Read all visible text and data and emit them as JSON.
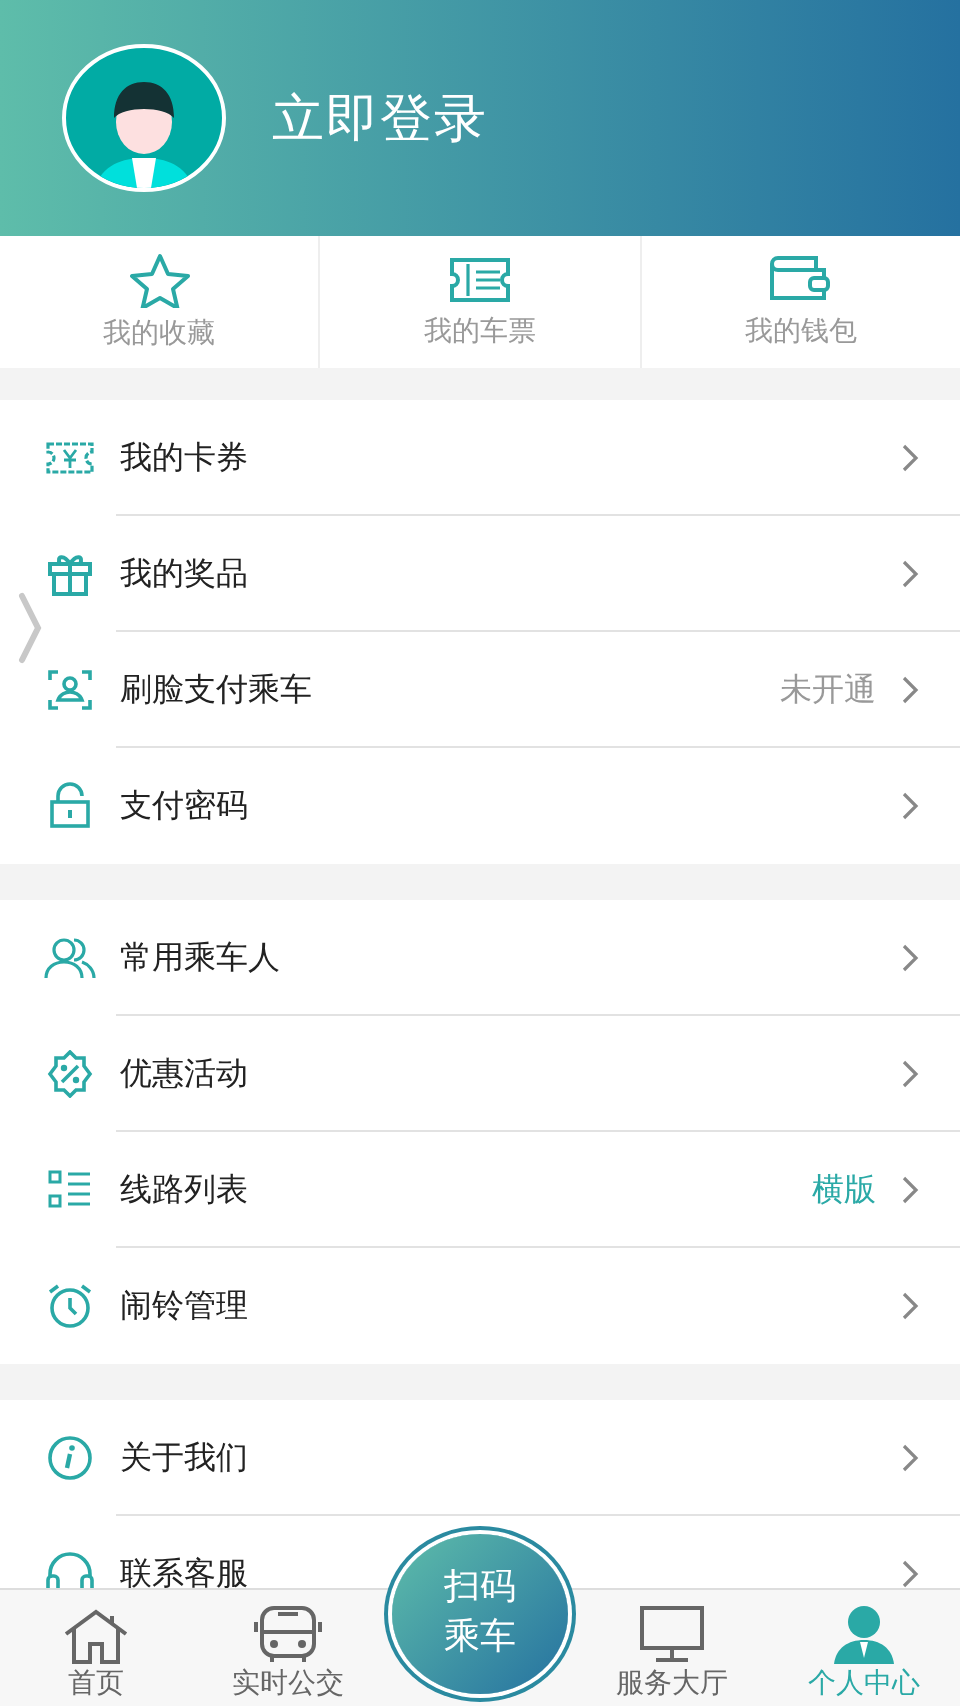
{
  "header": {
    "login_text": "立即登录"
  },
  "shortcuts": [
    {
      "label": "我的收藏"
    },
    {
      "label": "我的车票"
    },
    {
      "label": "我的钱包"
    }
  ],
  "menu_groups": [
    {
      "rows": [
        {
          "label": "我的卡券"
        },
        {
          "label": "我的奖品"
        },
        {
          "label": "刷脸支付乘车",
          "value": {
            "text": "未开通",
            "highlighted": false
          }
        },
        {
          "label": "支付密码"
        }
      ]
    },
    {
      "rows": [
        {
          "label": "常用乘车人"
        },
        {
          "label": "优惠活动"
        },
        {
          "label": "线路列表",
          "value": {
            "text": "横版",
            "highlighted": true
          }
        },
        {
          "label": "闹铃管理"
        }
      ]
    },
    {
      "rows": [
        {
          "label": "关于我们"
        },
        {
          "label": "联系客服"
        }
      ]
    }
  ],
  "scan_button": {
    "line_1": "扫码",
    "line_2": "乘车"
  },
  "tab_bar": [
    {
      "label": "首页",
      "selected": false
    },
    {
      "label": "实时公交",
      "selected": false
    },
    {
      "label": "服务大厅",
      "selected": false
    },
    {
      "label": "个人中心",
      "selected": true
    }
  ]
}
